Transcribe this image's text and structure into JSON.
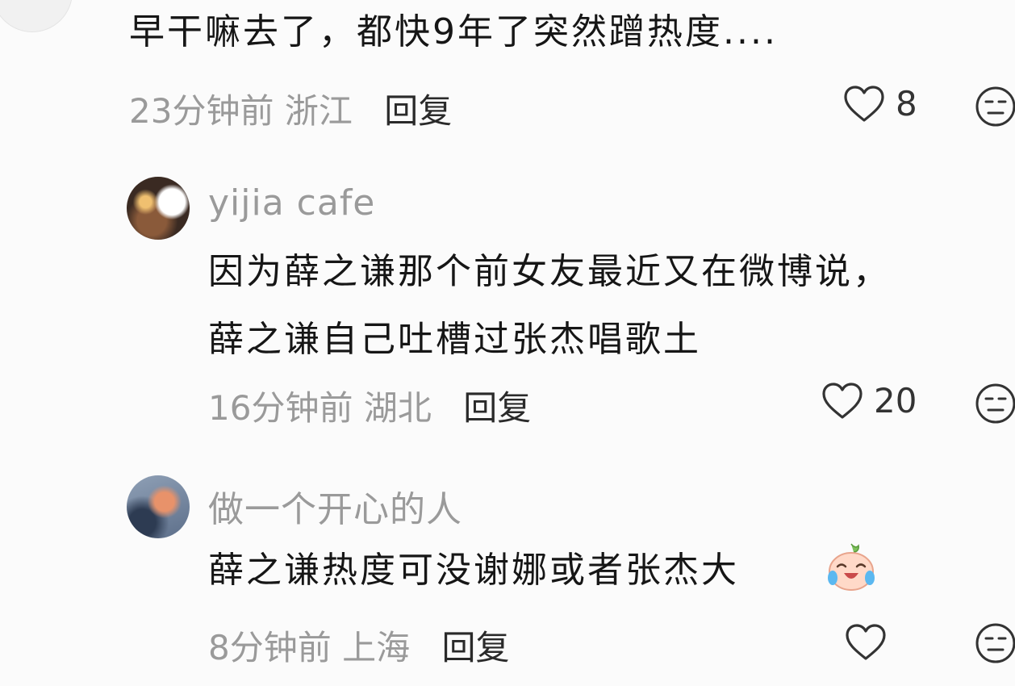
{
  "comments": [
    {
      "username": "",
      "lines": [
        "早干嘛去了，都快9年了突然蹭热度...."
      ],
      "time": "23分钟前",
      "location": "浙江",
      "reply": "回复",
      "likes": "8"
    },
    {
      "username": "yijia cafe",
      "lines": [
        "因为薛之谦那个前女友最近又在微博说，",
        "薛之谦自己吐槽过张杰唱歌土"
      ],
      "time": "16分钟前",
      "location": "湖北",
      "reply": "回复",
      "likes": "20"
    },
    {
      "username": "做一个开心的人",
      "lines": [
        "薛之谦热度可没谢娜或者张杰大"
      ],
      "time": "8分钟前",
      "location": "上海",
      "reply": "回复",
      "likes": ""
    }
  ],
  "icons": {
    "like": "heart-outline-icon",
    "dislike": "neutral-face-icon",
    "emoji": "crying-laughing-emoji"
  }
}
